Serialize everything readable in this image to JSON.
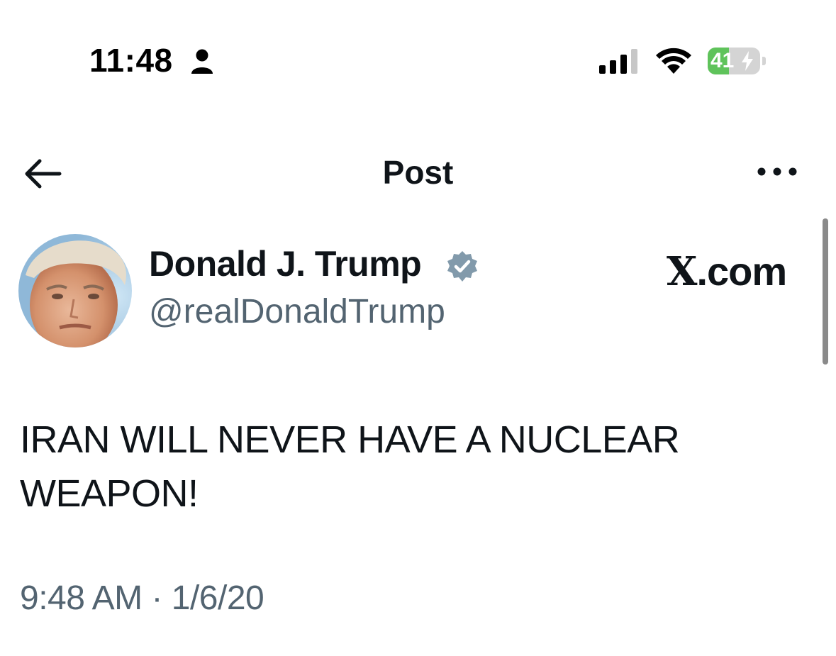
{
  "status_bar": {
    "time": "11:48",
    "battery_level": "41",
    "battery_fraction": 0.41,
    "icons": [
      "person-icon",
      "signal-icon",
      "wifi-icon",
      "charging-bolt-icon"
    ]
  },
  "nav": {
    "title": "Post",
    "back_icon": "arrow-left-icon",
    "more_icon": "more-icon"
  },
  "author": {
    "display_name": "Donald J. Trump",
    "handle": "@realDonaldTrump",
    "verified": true
  },
  "watermark": {
    "x_glyph": "X",
    "domain": ".com"
  },
  "post": {
    "text_line1": "IRAN WILL NEVER HAVE A NUCLEAR",
    "text_line2": "WEAPON!",
    "timestamp": "9:48 AM · 1/6/20"
  },
  "colors": {
    "text_primary": "#0f1419",
    "text_secondary": "#536471",
    "battery_green": "#5fc35b",
    "verified_badge": "#829aab"
  }
}
